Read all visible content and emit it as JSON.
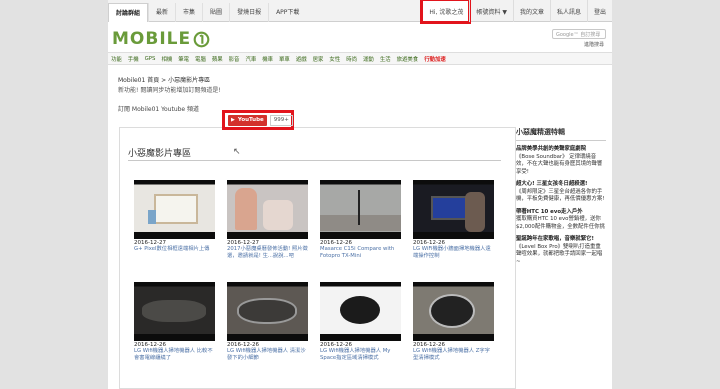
{
  "topnav": [
    "討論群組",
    "最新",
    "市集",
    "貼圖",
    "發燒日报",
    "APP下載"
  ],
  "usernav": {
    "greeting": "Hi, 沈歌之茂",
    "account_menu": "帳號資料 ▼",
    "my_posts": "我的文章",
    "private_msg": "私人訊息",
    "logout": "登出"
  },
  "logo_text": "MOBILE",
  "search": {
    "placeholder": "Google™ 自訂搜尋",
    "advanced": "進階搜尋"
  },
  "categories": [
    "功能",
    "手機",
    "GPS",
    "相機",
    "筆電",
    "電腦",
    "蘋果",
    "影音",
    "汽車",
    "機車",
    "單車",
    "遊戲",
    "居家",
    "女性",
    "時尚",
    "運動",
    "生活",
    "旅遊美食",
    "行動加速"
  ],
  "breadcrumb": "Mobile01 首頁 > 小惡魔影片專區",
  "notice": "新功能! 閱讀同步功能增加訂閱頻道是!",
  "subscribe_label": "訂閱 Mobile01 Youtube 頻道",
  "youtube": {
    "button": "YouTube",
    "count": "999+"
  },
  "panel_title": "小惡魔影片專區",
  "videos": [
    {
      "date": "2016-12-27",
      "title": "G+ Pixel數位相框遠端相片上傳"
    },
    {
      "date": "2016-12-27",
      "title": "2017小惡魔桌曆發佈活動! 照片徵選，邀請就是! 生...說說...吧"
    },
    {
      "date": "2016-12-26",
      "title": "Masarce C15i Compare with Fotopro TX-Mini"
    },
    {
      "date": "2016-12-26",
      "title": "LG WiFi機器小牆面掃地機器人遠端操作控制"
    },
    {
      "date": "2016-12-26",
      "title": "LG Wifi機器人掃地機器人 比較不會害電線纏繞了"
    },
    {
      "date": "2016-12-26",
      "title": "LG Wifi機器人掃地機器人 清潔沙發下的小細節"
    },
    {
      "date": "2016-12-26",
      "title": "LG Wifi機器人掃地機器人 My Space指定區域清掃模式"
    },
    {
      "date": "2016-12-26",
      "title": "LG Wifi機器人掃地機器人 Z字字型清掃模式"
    }
  ],
  "sidebar": {
    "title": "小惡魔精選特輯",
    "items": [
      {
        "head": "品牌美學共創的美聲家庭劇院",
        "body": "《Bose Soundbar》 定律環繞音效，不在大聲也能有身歷其境的聲響享受!"
      },
      {
        "head": "超大心! 三星女孩冬日超殺選!",
        "body": "《周邦限定》三星全台超過各你的手機，平板免費健康，再低價優惠方案!"
      },
      {
        "head": "帶著HTC 10 evo走入戶外",
        "body": "獲取購買HTC 10 evo營銷禮，送你$2,000配件購物金，全數配件任你挑"
      },
      {
        "head": "聖誕跨年在家歌唱，音樂就緊它!",
        "body": "《Level Box Pro》雙喇叭打造重重聲喧效果，就都把歌手請回家一起唱~"
      }
    ]
  }
}
